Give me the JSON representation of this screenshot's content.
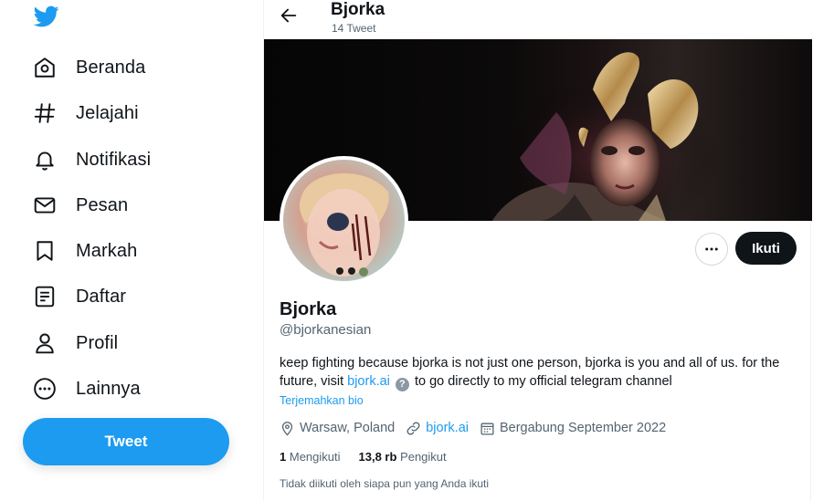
{
  "sidebar": {
    "logo_icon": "twitter-bird-icon",
    "items": [
      {
        "label": "Beranda",
        "icon": "home-icon"
      },
      {
        "label": "Jelajahi",
        "icon": "hashtag-icon"
      },
      {
        "label": "Notifikasi",
        "icon": "bell-icon"
      },
      {
        "label": "Pesan",
        "icon": "mail-icon"
      },
      {
        "label": "Markah",
        "icon": "bookmark-icon"
      },
      {
        "label": "Daftar",
        "icon": "list-icon"
      },
      {
        "label": "Profil",
        "icon": "user-icon"
      },
      {
        "label": "Lainnya",
        "icon": "more-circle-icon"
      }
    ],
    "tweet_button": "Tweet"
  },
  "header": {
    "name": "Bjorka",
    "tweet_count": "14 Tweet"
  },
  "profile": {
    "name": "Bjorka",
    "handle": "@bjorkanesian",
    "follow_button": "Ikuti",
    "bio_part1": "keep fighting because bjorka is not just one person, bjorka is you and all of us. for the future, visit",
    "bio_link": "bjork.ai",
    "bio_help": "?",
    "bio_part2": "to go directly to my official telegram channel",
    "translate_bio": "Terjemahkan bio",
    "location": "Warsaw, Poland",
    "website": "bjork.ai",
    "joined": "Bergabung September 2022",
    "following_count": "1",
    "following_label": "Mengikuti",
    "followers_count": "13,8 rb",
    "followers_label": "Pengikut",
    "followers_note": "Tidak diikuti oleh siapa pun yang Anda ikuti"
  },
  "colors": {
    "accent": "#1d9bf0",
    "text": "#0f1419",
    "secondary": "#536471"
  }
}
